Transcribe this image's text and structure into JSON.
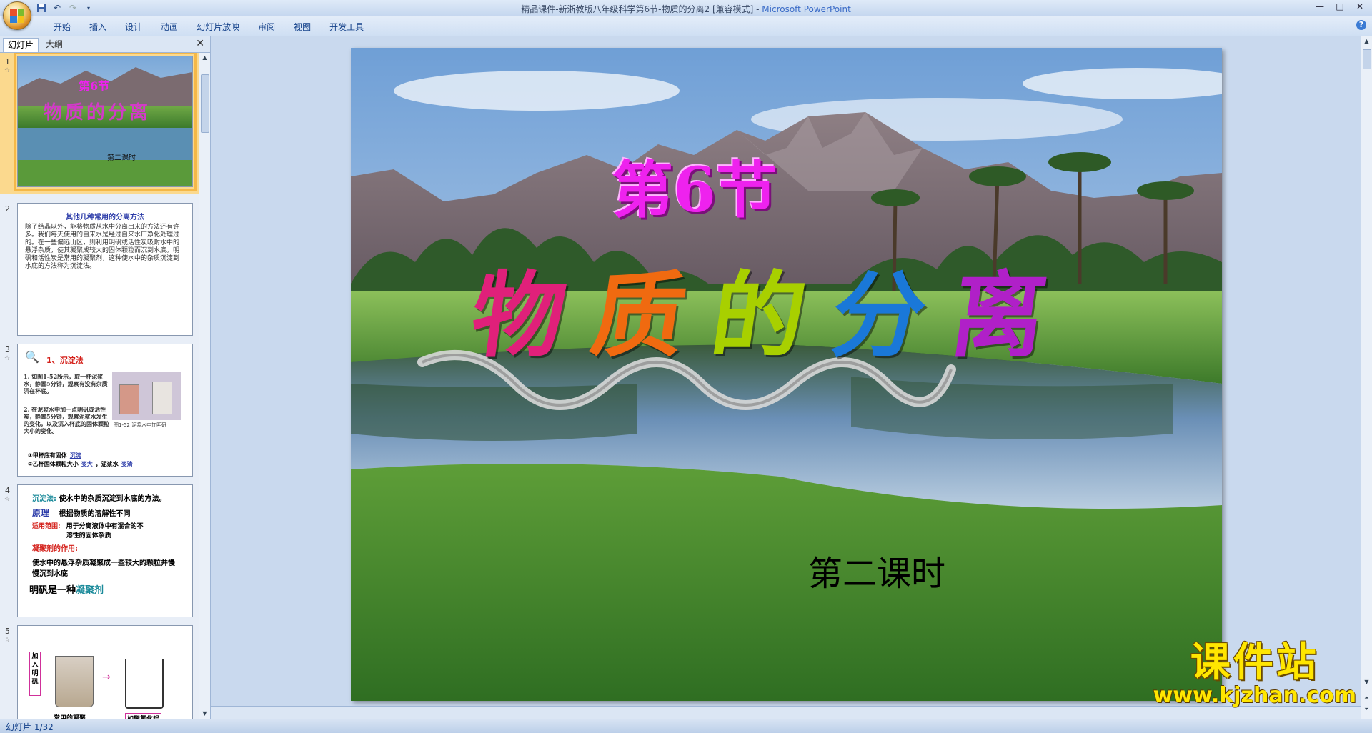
{
  "window": {
    "title": "精品课件-新浙教版八年级科学第6节-物质的分离2 [兼容模式] - ",
    "app_name": "Microsoft PowerPoint",
    "buttons": [
      "—",
      "□",
      "✕"
    ]
  },
  "menu": [
    "开始",
    "插入",
    "设计",
    "动画",
    "幻灯片放映",
    "审阅",
    "视图",
    "开发工具"
  ],
  "panel": {
    "tab_slides": "幻灯片",
    "tab_outline": "大纲",
    "close": "✕"
  },
  "thumbs": {
    "s1": {
      "num": "1",
      "title_a": "第6节",
      "title_b": "物质的分离",
      "sub": "第二课时"
    },
    "s2": {
      "num": "2",
      "title": "其他几种常用的分离方法",
      "body": "除了结晶以外，能将物质从水中分离出来的方法还有许多。我们每天使用的自来水是经过自来水厂净化处理过的。在一些偏远山区，则利用明矾或活性炭吸附水中的悬浮杂质，使其凝聚成较大的固体颗粒而沉到水底。明矾和活性炭是常用的凝聚剂，这种使水中的杂质沉淀到水底的方法称为沉淀法。"
    },
    "s3": {
      "num": "3",
      "heading": "1、沉淀法",
      "p1": "1. 如图1-52所示，取一杯泥浆水，静置5分钟，观察有没有杂质沉在杯底。",
      "p2": "2. 在泥浆水中加一点明矾或活性炭，静置5分钟，观察泥浆水发生的变化，以及沉入杯底的固体颗粒大小的变化。",
      "caption": "图1-52 泥浆水中加明矾",
      "q1": "①甲杯底有固体",
      "a1": "沉淀",
      "q2": "②乙杯固体颗粒大小",
      "a2": "变大",
      "q3": "，泥浆水",
      "a3": "变清"
    },
    "s4": {
      "num": "4",
      "l1a": "沉淀法:",
      "l1b": "使水中的杂质沉淀到水底的方法。",
      "l2a": "原理",
      "l2b": "根据物质的溶解性不同",
      "l3a": "适用范围:",
      "l3b": "用于分离液体中有混合的不溶性的固体杂质",
      "l4": "凝聚剂的作用:",
      "l5": "使水中的悬浮杂质凝聚成一些较大的颗粒并慢慢沉到水底",
      "l6a": "明矾是一种",
      "l6b": "凝聚剂"
    },
    "s5": {
      "num": "5",
      "v1": "加入明矾",
      "c1": "常用的凝聚",
      "c2": "如聚氯化铝"
    }
  },
  "slide": {
    "section": "第6节",
    "title_chars": [
      "物",
      "质",
      "的",
      "分",
      "离"
    ],
    "subtitle": "第二课时"
  },
  "status": "幻灯片 1/32",
  "watermark": {
    "big": "课件站",
    "url": "www.kjzhan.com"
  },
  "colors": {
    "section": "#ee22ee",
    "title": [
      "#e0207a",
      "#f06a10",
      "#a8d000",
      "#1a78d8",
      "#b020c8"
    ]
  }
}
